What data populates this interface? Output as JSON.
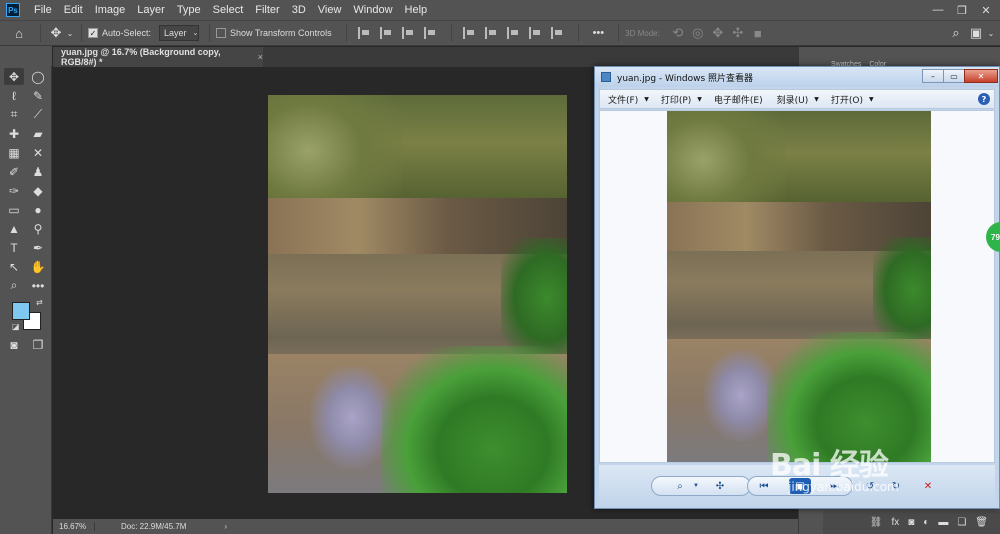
{
  "app": {
    "logo_text": "Ps",
    "menu": [
      "File",
      "Edit",
      "Image",
      "Layer",
      "Type",
      "Select",
      "Filter",
      "3D",
      "View",
      "Window",
      "Help"
    ],
    "window_controls": {
      "minimize": "—",
      "restore": "❐",
      "close": "✕"
    }
  },
  "options_bar": {
    "auto_select_label": "Auto-Select:",
    "auto_select_checked": true,
    "target_value": "Layer",
    "show_transform_label": "Show Transform Controls",
    "show_transform_checked": false,
    "more_label": "•••",
    "mode_3d_label": "3D Mode:"
  },
  "document": {
    "tab_title": "yuan.jpg @ 16.7% (Background copy, RGB/8#) *",
    "tab_close": "×",
    "zoom": "16.67%",
    "doc_info": "Doc: 22.9M/45.7M",
    "status_arrow": "›"
  },
  "panels": {
    "tabs": [
      "Swatches",
      "Color"
    ]
  },
  "colors": {
    "foreground": "#7fc8f2",
    "background": "#ffffff"
  },
  "viewer": {
    "title": "yuan.jpg - Windows 照片查看器",
    "menu": [
      {
        "label": "文件(F)"
      },
      {
        "label": "打印(P)"
      },
      {
        "label": "电子邮件(E)"
      },
      {
        "label": "刻录(U)"
      },
      {
        "label": "打开(O)"
      }
    ],
    "help": "?",
    "buttons": {
      "minimize": "–",
      "restore": "▭",
      "close": "✕"
    }
  },
  "badge": {
    "text": "79"
  },
  "watermark": {
    "text": "Bai 经验",
    "url": "jingyan.baidu.com"
  }
}
